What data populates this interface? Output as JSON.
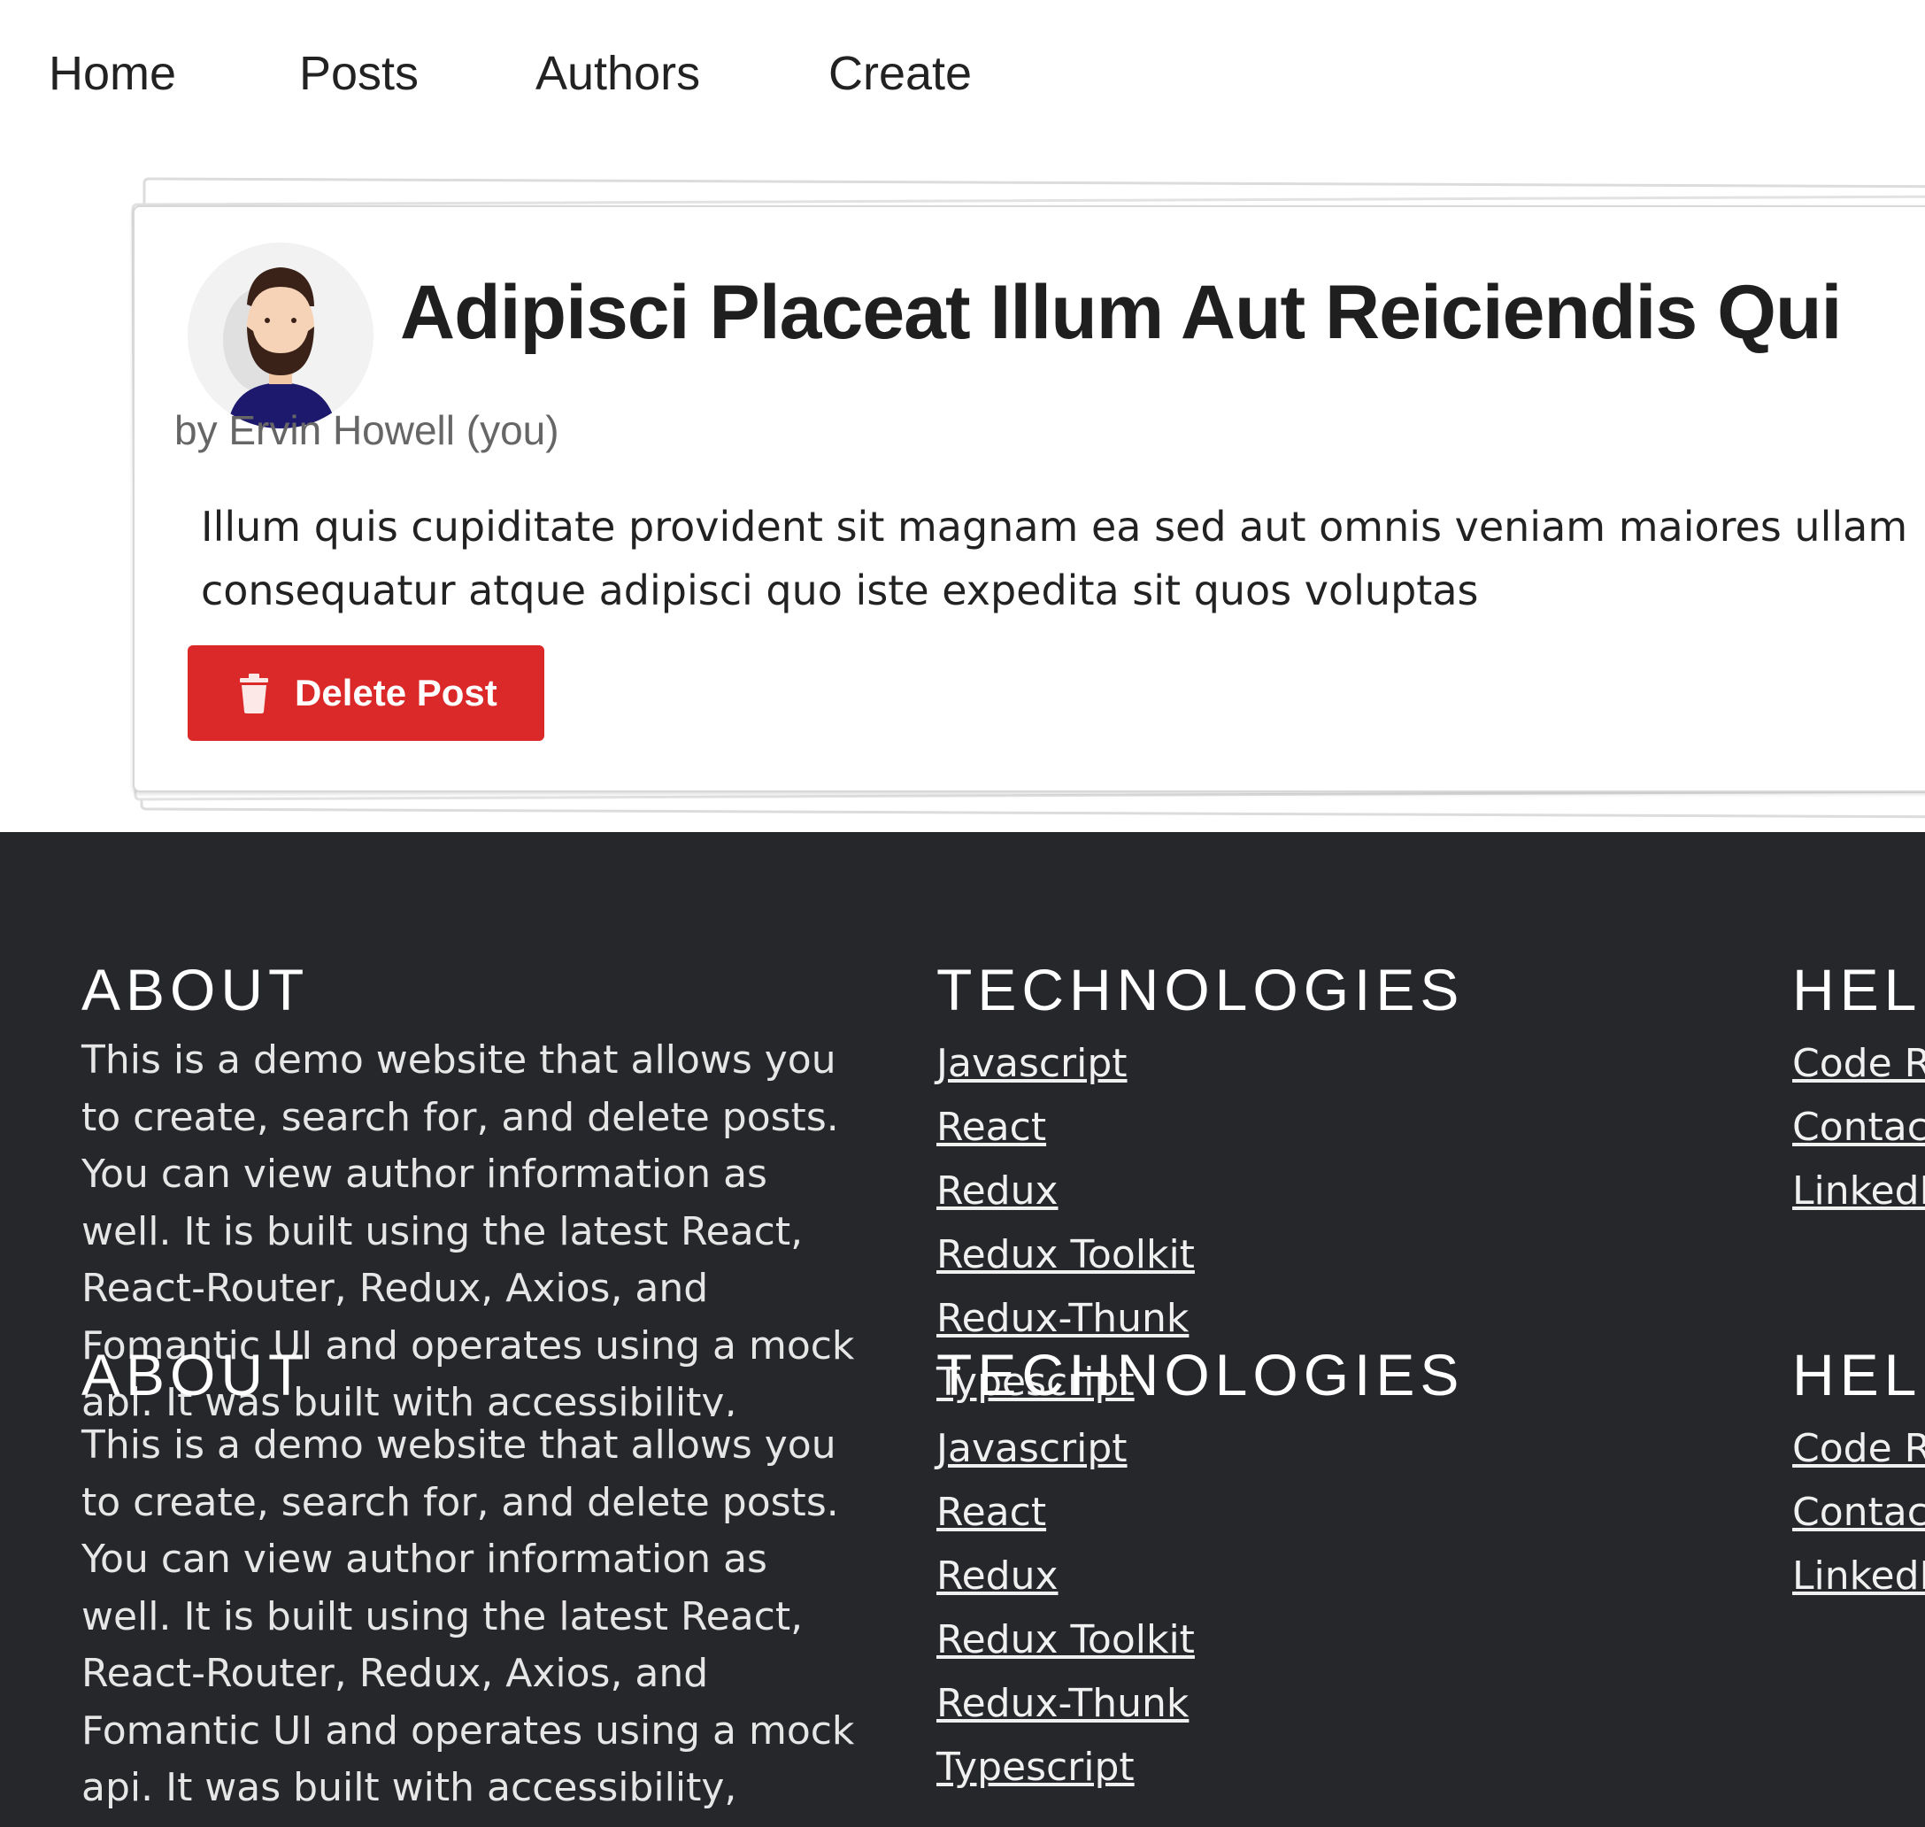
{
  "nav": {
    "home": "Home",
    "posts": "Posts",
    "authors": "Authors",
    "create": "Create"
  },
  "post": {
    "title": "Adipisci Placeat Illum Aut Reiciendis Qui",
    "byline": "by Ervin Howell (you)",
    "body": "Illum quis cupiditate provident sit magnam ea sed aut omnis veniam maiores ullam consequatur atque adipisci quo iste expedita sit quos voluptas",
    "delete_label": "Delete Post",
    "delete_color": "#db2828"
  },
  "footer": {
    "about": {
      "heading": "ABOUT",
      "text": "This is a demo website that allows you to create, search for, and delete posts. You can view author information as well. It is built using the latest React, React-Router, Redux, Axios, and Fomantic UI and operates using a mock api. It was built with accessibility, responsiveness, and aesthetics in mind."
    },
    "technologies": {
      "heading": "TECHNOLOGIES",
      "links": [
        "Javascript",
        "React",
        "Redux",
        "Redux Toolkit",
        "Redux-Thunk",
        "Typescript"
      ]
    },
    "help": {
      "heading": "HELP",
      "links": [
        "Code Repository",
        "Contact",
        "LinkedIn"
      ]
    },
    "background": "#26272b"
  }
}
